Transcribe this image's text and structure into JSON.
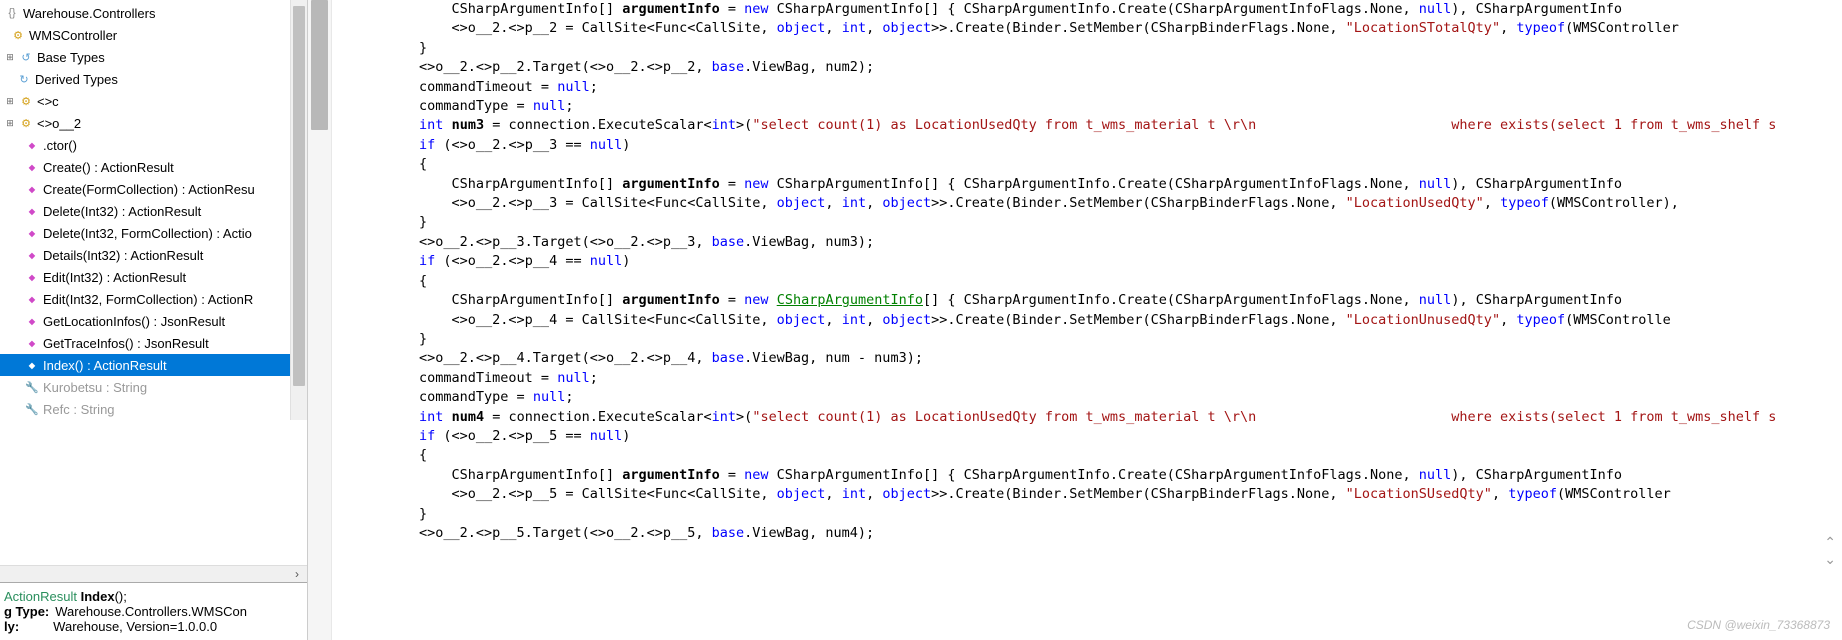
{
  "tree": {
    "ns": "Warehouse.Controllers",
    "cls": "WMSController",
    "baseTypes": "Base Types",
    "derivedTypes": "Derived Types",
    "genC": "<>c",
    "genO2": "<>o__2",
    "members": [
      ".ctor()",
      "Create() : ActionResult",
      "Create(FormCollection) : ActionResu",
      "Delete(Int32) : ActionResult",
      "Delete(Int32, FormCollection) : Actio",
      "Details(Int32) : ActionResult",
      "Edit(Int32) : ActionResult",
      "Edit(Int32, FormCollection) : ActionR",
      "GetLocationInfos() : JsonResult",
      "GetTraceInfos() : JsonResult"
    ],
    "selected": "Index() : ActionResult",
    "props": [
      "Kurobetsu : String",
      "Refc : String"
    ]
  },
  "info": {
    "sigType": "ActionResult",
    "sigName": "Index",
    "typeLbl": "g Type:",
    "typeVal": "Warehouse.Controllers.WMSCon",
    "asmLbl": "ly:",
    "asmVal": "Warehouse, Version=1.0.0.0"
  },
  "code": {
    "l00a": "            CSharpArgumentInfo[] ",
    "l00b": "argumentInfo",
    "l00c": " = ",
    "l00d": "new",
    "l00e": " CSharpArgumentInfo[] { CSharpArgumentInfo.Create(CSharpArgumentInfoFlags.None, ",
    "l00f": "null",
    "l00g": "), CSharpArgumentInfo",
    "l01a": "            <>o__2.<>p__2 = CallSite<Func<CallSite, ",
    "l01b": "object",
    "l01c": ", ",
    "l01d": "int",
    "l01e": ", ",
    "l01f": "object",
    "l01g": ">>.Create(Binder.SetMember(CSharpBinderFlags.None, ",
    "l01h": "\"LocationSTotalQty\"",
    "l01i": ", ",
    "l01j": "typeof",
    "l01k": "(WMSController",
    "l02": "        }",
    "l03a": "        <>o__2.<>p__2.Target(<>o__2.<>p__2, ",
    "l03b": "base",
    "l03c": ".ViewBag, num2);",
    "l04a": "        commandTimeout = ",
    "l04b": "null",
    "l04c": ";",
    "l05a": "        commandType = ",
    "l05b": "null",
    "l05c": ";",
    "l06a": "        ",
    "l06b": "int",
    "l06c": " ",
    "l06d": "num3",
    "l06e": " = connection.ExecuteScalar<",
    "l06f": "int",
    "l06g": ">(",
    "l06h": "\"select count(1) as LocationUsedQty from t_wms_material t \\r\\n                        where exists(select 1 from t_wms_shelf s",
    "l07a": "        ",
    "l07b": "if",
    "l07c": " (<>o__2.<>p__3 == ",
    "l07d": "null",
    "l07e": ")",
    "l08": "        {",
    "l09a": "            CSharpArgumentInfo[] ",
    "l09b": "argumentInfo",
    "l09c": " = ",
    "l09d": "new",
    "l09e": " CSharpArgumentInfo[] { CSharpArgumentInfo.Create(CSharpArgumentInfoFlags.None, ",
    "l09f": "null",
    "l09g": "), CSharpArgumentInfo",
    "l10a": "            <>o__2.<>p__3 = CallSite<Func<CallSite, ",
    "l10b": "object",
    "l10c": ", ",
    "l10d": "int",
    "l10e": ", ",
    "l10f": "object",
    "l10g": ">>.Create(Binder.SetMember(CSharpBinderFlags.None, ",
    "l10h": "\"LocationUsedQty\"",
    "l10i": ", ",
    "l10j": "typeof",
    "l10k": "(WMSController),",
    "l11": "        }",
    "l12a": "        <>o__2.<>p__3.Target(<>o__2.<>p__3, ",
    "l12b": "base",
    "l12c": ".ViewBag, num3);",
    "l13a": "        ",
    "l13b": "if",
    "l13c": " (<>o__2.<>p__4 == ",
    "l13d": "null",
    "l13e": ")",
    "l14": "        {",
    "l15a": "            CSharpArgumentInfo[] ",
    "l15b": "argumentInfo",
    "l15c": " = ",
    "l15d": "new",
    "l15e": " ",
    "l15f": "CSharpArgumentInfo",
    "l15g": "[] { CSharpArgumentInfo.Create(CSharpArgumentInfoFlags.None, ",
    "l15h": "null",
    "l15i": "), CSharpArgumentInfo",
    "l16a": "            <>o__2.<>p__4 = CallSite<Func<CallSite, ",
    "l16b": "object",
    "l16c": ", ",
    "l16d": "int",
    "l16e": ", ",
    "l16f": "object",
    "l16g": ">>.Create(Binder.SetMember(CSharpBinderFlags.None, ",
    "l16h": "\"LocationUnusedQty\"",
    "l16i": ", ",
    "l16j": "typeof",
    "l16k": "(WMSControlle",
    "l17": "        }",
    "l18a": "        <>o__2.<>p__4.Target(<>o__2.<>p__4, ",
    "l18b": "base",
    "l18c": ".ViewBag, num - num3);",
    "l19a": "        commandTimeout = ",
    "l19b": "null",
    "l19c": ";",
    "l20a": "        commandType = ",
    "l20b": "null",
    "l20c": ";",
    "l21a": "        ",
    "l21b": "int",
    "l21c": " ",
    "l21d": "num4",
    "l21e": " = connection.ExecuteScalar<",
    "l21f": "int",
    "l21g": ">(",
    "l21h": "\"select count(1) as LocationUsedQty from t_wms_material t \\r\\n                        where exists(select 1 from t_wms_shelf s",
    "l22a": "        ",
    "l22b": "if",
    "l22c": " (<>o__2.<>p__5 == ",
    "l22d": "null",
    "l22e": ")",
    "l23": "        {",
    "l24a": "            CSharpArgumentInfo[] ",
    "l24b": "argumentInfo",
    "l24c": " = ",
    "l24d": "new",
    "l24e": " CSharpArgumentInfo[] { CSharpArgumentInfo.Create(CSharpArgumentInfoFlags.None, ",
    "l24f": "null",
    "l24g": "), CSharpArgumentInfo",
    "l25a": "            <>o__2.<>p__5 = CallSite<Func<CallSite, ",
    "l25b": "object",
    "l25c": ", ",
    "l25d": "int",
    "l25e": ", ",
    "l25f": "object",
    "l25g": ">>.Create(Binder.SetMember(CSharpBinderFlags.None, ",
    "l25h": "\"LocationSUsedQty\"",
    "l25i": ", ",
    "l25j": "typeof",
    "l25k": "(WMSController",
    "l26": "        }",
    "l27a": "        <>o__2.<>p__5.Target(<>o__2.<>p__5, ",
    "l27b": "base",
    "l27c": ".ViewBag, num4);"
  },
  "watermark": "CSDN @weixin_73368873"
}
